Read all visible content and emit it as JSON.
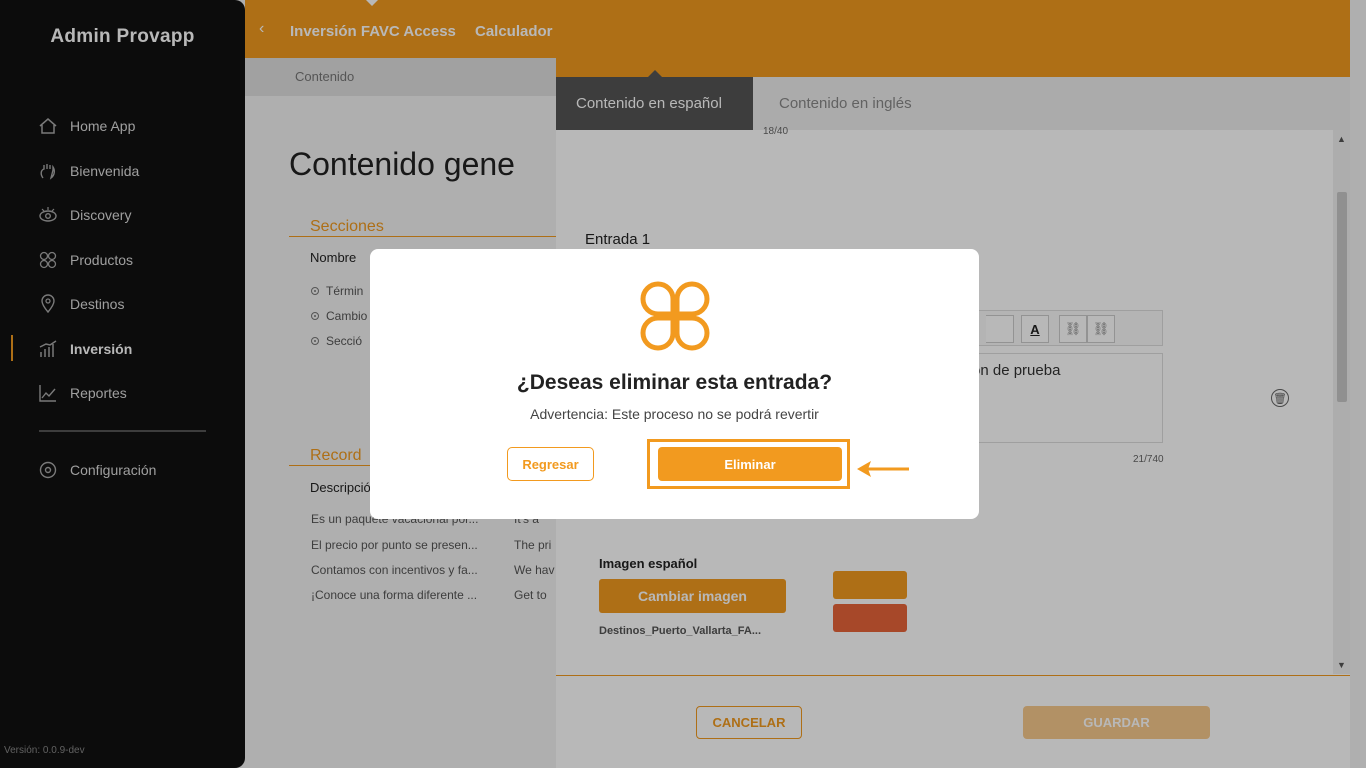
{
  "sidebar": {
    "brand": "Admin Provapp",
    "items": [
      {
        "label": "Home App",
        "icon": "home-icon"
      },
      {
        "label": "Bienvenida",
        "icon": "wave-hand-icon"
      },
      {
        "label": "Discovery",
        "icon": "eye-icon"
      },
      {
        "label": "Productos",
        "icon": "grid-icon"
      },
      {
        "label": "Destinos",
        "icon": "location-pin-icon"
      },
      {
        "label": "Inversión",
        "icon": "bar-chart-icon",
        "active": true
      },
      {
        "label": "Reportes",
        "icon": "line-chart-icon"
      }
    ],
    "settings_label": "Configuración",
    "version": "Versión: 0.0.9-dev"
  },
  "topbar": {
    "tab1": "Inversión FAVC Access",
    "tab2": "Calculador"
  },
  "subbar": {
    "label": "Contenido"
  },
  "main": {
    "title": "Contenido gene",
    "sections_heading": "Secciones",
    "name_col": "Nombre",
    "bullets": [
      "Términ",
      "Cambio",
      "Secció"
    ],
    "records_heading": "Record",
    "desc_col": "Descripció",
    "rows": [
      {
        "es": "Es un paquete vacacional por...",
        "en": "It's a"
      },
      {
        "es": "El precio por punto se presen...",
        "en": "The pri"
      },
      {
        "es": "Contamos con incentivos y fa...",
        "en": "We hav"
      },
      {
        "es": "¡Conoce una forma diferente ...",
        "en": "Get to"
      }
    ]
  },
  "panel": {
    "tab_es": "Contenido en español",
    "tab_en": "Contenido en inglés",
    "counter_top": "18/40",
    "entry_label": "Entrada 1",
    "editor_text": "on de prueba",
    "counter_editor": "21/740",
    "image_label": "Imagen español",
    "change_image": "Cambiar imagen",
    "image_file": "Destinos_Puerto_Vallarta_FA...",
    "cancel": "CANCELAR",
    "save": "GUARDAR"
  },
  "modal": {
    "title": "¿Deseas eliminar esta entrada?",
    "warning": "Advertencia: Este proceso no se podrá revertir",
    "back": "Regresar",
    "delete": "Eliminar"
  },
  "colors": {
    "accent": "#f29a1f",
    "sidebar_bg": "#111111"
  }
}
